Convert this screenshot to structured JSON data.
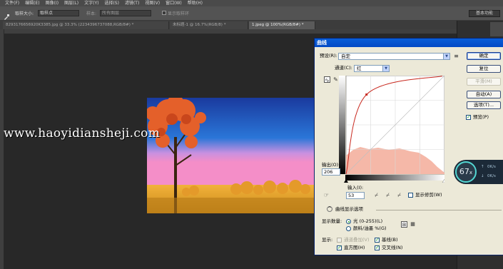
{
  "menubar": {
    "items": [
      "文件(F)",
      "编辑(E)",
      "图像(I)",
      "图层(L)",
      "文字(Y)",
      "选择(S)",
      "滤镜(T)",
      "视图(V)",
      "窗口(W)",
      "帮助(H)"
    ]
  },
  "options": {
    "sample_size_label": "取样大小:",
    "sample_size_value": "取样点",
    "sample_label": "样本:",
    "sample_value": "所有图层",
    "show_ring_label": "显示取样环",
    "workspace": "基本功能"
  },
  "tabs": [
    "8293176656920K3385.jpg @ 33.3% (2234396737088,RGB/8#) *",
    "未标题-1 @ 16.7%(RGB/8) *",
    "1.jpeg @ 100%(RGB/8#) *"
  ],
  "watermark": "www.haoyidiansheji.com",
  "dialog": {
    "title": "曲线",
    "preset_label": "预设(R):",
    "preset_value": "自定",
    "channel_label": "通道(C):",
    "channel_value": "红",
    "output_label": "输出(O):",
    "output_value": "206",
    "input_label": "输入(I):",
    "input_value": "53",
    "show_clipping_label": "显示修剪(W)",
    "display_options_label": "曲线显示选项",
    "show_amount_label": "显示数量:",
    "light_label": "光 (0-255)(L)",
    "pigment_label": "颜料/油墨 %(G)",
    "show_label": "显示:",
    "channel_overlay_label": "通道叠加(V)",
    "baseline_label": "基线(B)",
    "histogram_label": "直方图(H)",
    "intersection_label": "交叉线(N)",
    "buttons": {
      "ok": "确定",
      "reset": "复位",
      "smooth": "平滑(M)",
      "auto": "自动(A)",
      "options": "选项(T)...",
      "preview": "预览(P)"
    }
  },
  "curve": {
    "channel_color": "#c8281e",
    "points": [
      [
        0,
        0
      ],
      [
        53,
        206
      ],
      [
        255,
        255
      ]
    ]
  },
  "gauge": {
    "percent": "67",
    "unit": "x",
    "up_value": "0K/s",
    "down_value": "0K/s"
  }
}
